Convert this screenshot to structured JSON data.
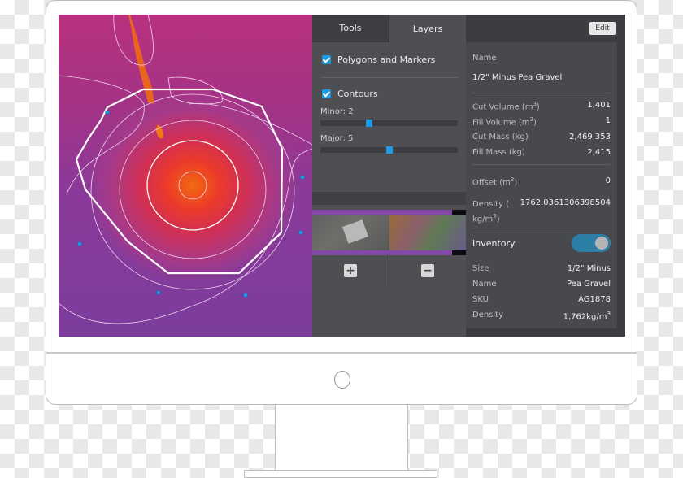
{
  "layers_panel": {
    "tabs": [
      {
        "label": "Tools",
        "active": false
      },
      {
        "label": "Layers",
        "active": true
      }
    ],
    "layers": [
      {
        "label": "Polygons and Markers",
        "checked": true
      },
      {
        "label": "Contours",
        "checked": true
      }
    ],
    "sliders": [
      {
        "label": "Minor: 2",
        "value_fraction": 0.33
      },
      {
        "label": "Major: 5",
        "value_fraction": 0.5
      }
    ],
    "basemaps": [
      {
        "name": "satellite-thumbnail",
        "selected": false
      },
      {
        "name": "elevation-thumbnail",
        "selected": true
      }
    ],
    "zoom_in_label": "+",
    "zoom_out_label": "−",
    "checkmark": "✓"
  },
  "properties": {
    "edit_label": "Edit",
    "name_label": "Name",
    "name_value": "1/2\" Minus Pea Gravel",
    "metrics": [
      {
        "label": "Cut Volume (m",
        "sup": "3",
        "suffix": ")",
        "value": "1,401"
      },
      {
        "label": "Fill Volume (m",
        "sup": "3",
        "suffix": ")",
        "value": "1"
      },
      {
        "label": "Cut Mass  (kg)",
        "sup": "",
        "suffix": "",
        "value": "2,469,353"
      },
      {
        "label": "Fill Mass  (kg)",
        "sup": "",
        "suffix": "",
        "value": "2,415"
      }
    ],
    "offset_label": "Offset (m",
    "offset_sup": "3",
    "offset_suffix": ")",
    "offset_value": "0",
    "density_label_line1": "Density (",
    "density_label_line2": "kg/m",
    "density_sup": "3",
    "density_suffix": ")",
    "density_value": "1762.0361306398504",
    "inventory_label": "Inventory",
    "inventory_on": true,
    "inventory_items": [
      {
        "label": "Size",
        "value": "1/2\" Minus"
      },
      {
        "label": "Name",
        "value": "Pea Gravel"
      },
      {
        "label": "SKU",
        "value": "AG1878"
      }
    ],
    "inv_density_label": "Density",
    "inv_density_value": "1,762kg/m",
    "inv_density_sup": "3"
  },
  "map": {
    "colors": {
      "low": "#7c3d9c",
      "mid": "#d02f55",
      "high": "#f16a10",
      "polygon": "#ffffff",
      "marker": "#1e9be8"
    }
  }
}
